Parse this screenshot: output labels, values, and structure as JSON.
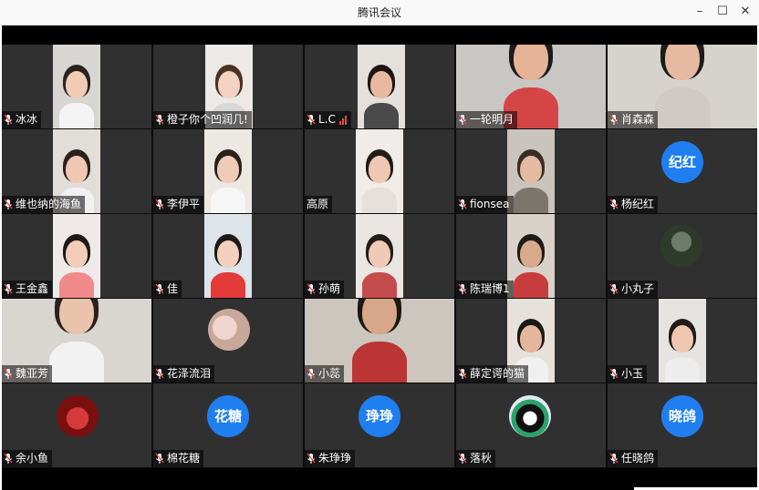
{
  "window": {
    "title": "腾讯会议",
    "minimize_icon": "minimize-icon",
    "maximize_icon": "maximize-icon",
    "close_icon": "close-icon"
  },
  "accent_color": "#1f7ff0",
  "participants": [
    {
      "name": "冰冰",
      "muted": true,
      "type": "video"
    },
    {
      "name": "橙子你个凹润几!",
      "muted": true,
      "type": "video"
    },
    {
      "name": "L.C",
      "muted": true,
      "type": "video",
      "signal": "weak"
    },
    {
      "name": "一轮明月",
      "muted": true,
      "type": "video"
    },
    {
      "name": "肖森森",
      "muted": true,
      "type": "video"
    },
    {
      "name": "维也纳的海鱼",
      "muted": true,
      "type": "video"
    },
    {
      "name": "李伊平",
      "muted": true,
      "type": "video"
    },
    {
      "name": "高原",
      "muted": false,
      "type": "video"
    },
    {
      "name": "fionsea",
      "muted": true,
      "type": "video"
    },
    {
      "name": "杨纪红",
      "muted": true,
      "type": "avatar",
      "avatar_text": "纪红"
    },
    {
      "name": "王金鑫",
      "muted": true,
      "type": "video"
    },
    {
      "name": "佳",
      "muted": true,
      "type": "video"
    },
    {
      "name": "孙萌",
      "muted": true,
      "type": "video"
    },
    {
      "name": "陈瑞博1",
      "muted": true,
      "type": "video"
    },
    {
      "name": "小丸子",
      "muted": true,
      "type": "avatar-image"
    },
    {
      "name": "魏亚芳",
      "muted": true,
      "type": "video"
    },
    {
      "name": "花泽流泪",
      "muted": true,
      "type": "avatar-image"
    },
    {
      "name": "小蕊",
      "muted": true,
      "type": "video"
    },
    {
      "name": "薛定谔的猫",
      "muted": true,
      "type": "video"
    },
    {
      "name": "小玉",
      "muted": true,
      "type": "video"
    },
    {
      "name": "余小鱼",
      "muted": true,
      "type": "avatar-image"
    },
    {
      "name": "棉花糖",
      "muted": true,
      "type": "avatar",
      "avatar_text": "花糖"
    },
    {
      "name": "朱琤琤",
      "muted": true,
      "type": "avatar",
      "avatar_text": "琤琤"
    },
    {
      "name": "落秋",
      "muted": true,
      "type": "avatar-image"
    },
    {
      "name": "任晓鸽",
      "muted": true,
      "type": "avatar",
      "avatar_text": "晓鸽"
    }
  ]
}
